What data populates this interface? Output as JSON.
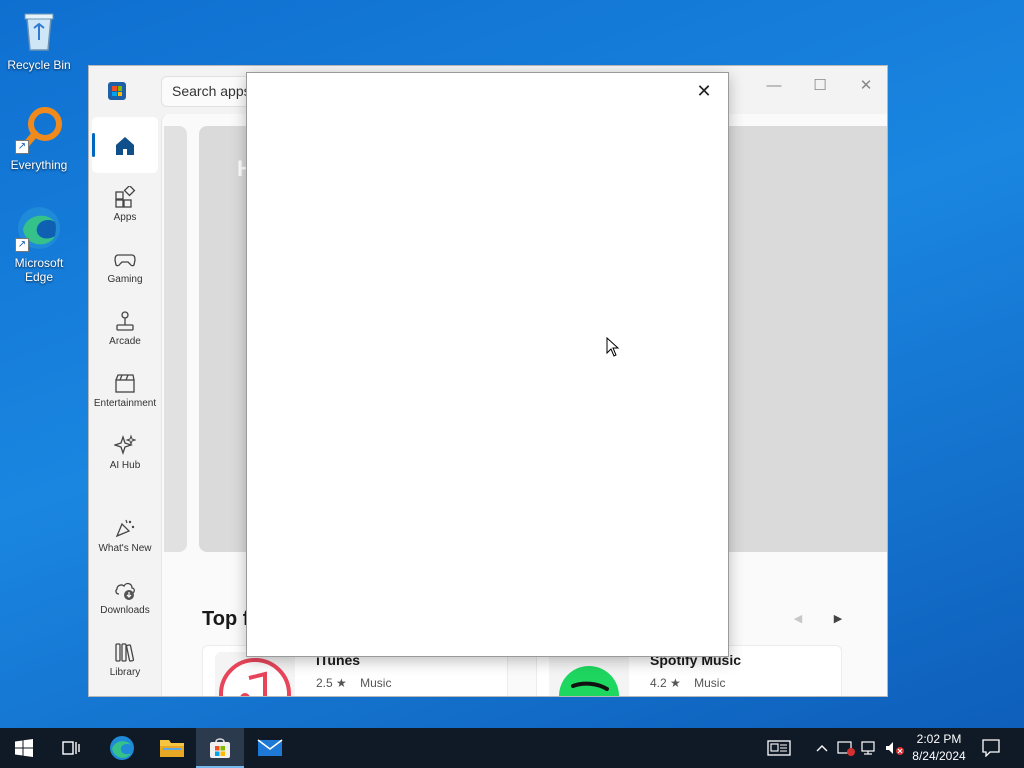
{
  "desktop": {
    "icons": [
      {
        "label": "Recycle Bin"
      },
      {
        "label": "Everything"
      },
      {
        "label": "Microsoft Edge"
      }
    ]
  },
  "store": {
    "search_placeholder": "Search apps",
    "nav": [
      {
        "label": "Apps"
      },
      {
        "label": "Gaming"
      },
      {
        "label": "Arcade"
      },
      {
        "label": "Entertainment"
      },
      {
        "label": "AI Hub"
      },
      {
        "label": "What's New"
      },
      {
        "label": "Downloads"
      },
      {
        "label": "Library"
      }
    ],
    "hero_partial_text": "H",
    "section_title": "Top f",
    "apps": [
      {
        "name": "iTunes",
        "rating": "2.5 ★",
        "category": "Music"
      },
      {
        "name": "Spotify Music",
        "rating": "4.2 ★",
        "category": "Music"
      }
    ],
    "window_controls": {
      "minimize": "—",
      "maximize": "☐",
      "close": "✕"
    },
    "carousel": {
      "prev": "◀",
      "next": "▶"
    }
  },
  "dialog": {
    "close": "✕"
  },
  "taskbar": {
    "clock_time": "2:02 PM",
    "clock_date": "8/24/2024"
  },
  "colors": {
    "accent": "#0067c0",
    "taskbar_bg": "#101a26",
    "desktop_bg": "#1a86e0"
  }
}
